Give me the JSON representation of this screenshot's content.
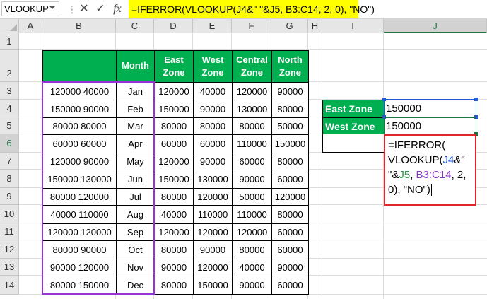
{
  "name_box": "VLOOKUP",
  "formula_bar": {
    "cancel_icon": "✕",
    "enter_icon": "✓",
    "fx_icon": "fx",
    "formula": "=IFERROR(VLOOKUP(J4&\" \"&J5, B3:C14, 2, 0), \"NO\")"
  },
  "columns": [
    "A",
    "B",
    "C",
    "D",
    "E",
    "F",
    "G",
    "H",
    "I",
    "J"
  ],
  "rows": [
    "1",
    "2",
    "3",
    "4",
    "5",
    "6",
    "7",
    "8",
    "9",
    "10",
    "11",
    "12",
    "13",
    "14"
  ],
  "table": {
    "headers": {
      "month": "Month",
      "east": [
        "East",
        "Zone"
      ],
      "west": [
        "West",
        "Zone"
      ],
      "central": [
        "Central",
        "Zone"
      ],
      "north": [
        "North",
        "Zone"
      ]
    },
    "data": [
      [
        "120000 40000",
        "Jan",
        "120000",
        "40000",
        "120000",
        "90000"
      ],
      [
        "150000 90000",
        "Feb",
        "150000",
        "90000",
        "130000",
        "80000"
      ],
      [
        "80000 80000",
        "Mar",
        "80000",
        "80000",
        "80000",
        "50000"
      ],
      [
        "60000 60000",
        "Apr",
        "60000",
        "60000",
        "110000",
        "150000"
      ],
      [
        "120000 90000",
        "May",
        "120000",
        "90000",
        "60000",
        "80000"
      ],
      [
        "150000 130000",
        "Jun",
        "150000",
        "130000",
        "90000",
        "60000"
      ],
      [
        "80000 120000",
        "Jul",
        "80000",
        "120000",
        "50000",
        "120000"
      ],
      [
        "40000 110000",
        "Aug",
        "40000",
        "110000",
        "110000",
        "80000"
      ],
      [
        "120000 120000",
        "Sep",
        "120000",
        "120000",
        "120000",
        "60000"
      ],
      [
        "80000 90000",
        "Oct",
        "80000",
        "90000",
        "80000",
        "60000"
      ],
      [
        "90000 120000",
        "Nov",
        "90000",
        "120000",
        "40000",
        "90000"
      ],
      [
        "80000 150000",
        "Dec",
        "80000",
        "150000",
        "90000",
        "60000"
      ]
    ]
  },
  "lookup": {
    "east_label": "East Zone",
    "east_value": "150000",
    "west_label": "West Zone",
    "west_value": "150000"
  },
  "edit_cell": {
    "p1": "=IFERROR(",
    "p2": "VLOOKUP(",
    "p3": "J4",
    "p4": "&\"",
    "p5": "\"&",
    "p6": "J5",
    "p7": ", ",
    "p8": "B3:C14",
    "p9": ", 2,",
    "p10": "0), \"NO\")"
  },
  "colors": {
    "header_green": "#00b050",
    "formula_highlight": "#ffff00",
    "ref_blue": "#1a4fd6",
    "ref_green": "#22a04a",
    "ref_purple": "#8a34c8",
    "edit_border": "#e0262a"
  }
}
